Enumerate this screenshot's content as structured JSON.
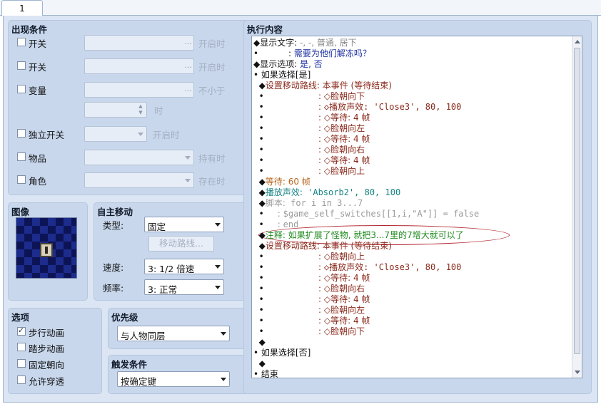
{
  "tab": {
    "label": "1"
  },
  "conditions": {
    "title": "出现条件",
    "switch1": {
      "label": "开关",
      "value": "...",
      "suffix": "开启时"
    },
    "switch2": {
      "label": "开关",
      "value": "...",
      "suffix": "开启时"
    },
    "variable": {
      "label": "变量",
      "value": "...",
      "suffix": "不小于",
      "amount_suffix": "时"
    },
    "self_switch": {
      "label": "独立开关",
      "suffix": "开启时"
    },
    "item": {
      "label": "物品",
      "suffix": "持有时"
    },
    "actor": {
      "label": "角色",
      "suffix": "存在时"
    }
  },
  "image": {
    "title": "图像"
  },
  "autonomous": {
    "title": "自主移动",
    "type_label": "类型:",
    "type_value": "固定",
    "route_button": "移动路线...",
    "speed_label": "速度:",
    "speed_value": "3: 1/2 倍速",
    "freq_label": "频率:",
    "freq_value": "3: 正常"
  },
  "options": {
    "title": "选项",
    "items": [
      {
        "label": "步行动画",
        "checked": true
      },
      {
        "label": "踏步动画",
        "checked": false
      },
      {
        "label": "固定朝向",
        "checked": false
      },
      {
        "label": "允许穿透",
        "checked": false
      }
    ]
  },
  "priority": {
    "title": "优先级",
    "value": "与人物同层"
  },
  "trigger": {
    "title": "触发条件",
    "value": "按确定键"
  },
  "contents": {
    "title": "执行内容",
    "colors": {
      "command": "#111111",
      "param": "#8a8a8a",
      "blue": "#1b2fa0",
      "brown": "#8a2a1c",
      "orange": "#b8641a",
      "teal": "#178383",
      "green": "#1f8a1f",
      "gray": "#9a9a9a"
    },
    "lines": [
      {
        "prefix": "◆",
        "head": "显示文字:",
        "text": " -, -, 普通, 居下",
        "color": "param"
      },
      {
        "prefix": "•",
        "head": "           : ",
        "text": "需要为他们解冻吗？",
        "color": "blue"
      },
      {
        "prefix": "◆",
        "head": "显示选项:",
        "text": " 是, 否",
        "color": "blue"
      },
      {
        "prefix": "•",
        "head": " 如果选择[是]",
        "text": "",
        "color": "command"
      },
      {
        "prefix": "  ◆",
        "head": "设置移动路线:",
        "text": " 本事件 (等待结束)",
        "color": "brown"
      },
      {
        "prefix": "  •",
        "head": "                    : ",
        "text": "◇脸朝向下",
        "color": "brown"
      },
      {
        "prefix": "  •",
        "head": "                    : ",
        "text": "◇播放声效: 'Close3', 80, 100",
        "color": "brown"
      },
      {
        "prefix": "  •",
        "head": "                    : ",
        "text": "◇等待: 4 帧",
        "color": "brown"
      },
      {
        "prefix": "  •",
        "head": "                    : ",
        "text": "◇脸朝向左",
        "color": "brown"
      },
      {
        "prefix": "  •",
        "head": "                    : ",
        "text": "◇等待: 4 帧",
        "color": "brown"
      },
      {
        "prefix": "  •",
        "head": "                    : ",
        "text": "◇脸朝向右",
        "color": "brown"
      },
      {
        "prefix": "  •",
        "head": "                    : ",
        "text": "◇等待: 4 帧",
        "color": "brown"
      },
      {
        "prefix": "  •",
        "head": "                    : ",
        "text": "◇脸朝向上",
        "color": "brown"
      },
      {
        "prefix": "  ◆",
        "head": "等待:",
        "text": " 60 帧",
        "color": "orange"
      },
      {
        "prefix": "  ◆",
        "head": "播放声效:",
        "text": " 'Absorb2', 80, 100",
        "color": "teal"
      },
      {
        "prefix": "  ◆",
        "head": "脚本:",
        "text": " for i in 3...7",
        "color": "gray"
      },
      {
        "prefix": "  •",
        "head": "     : ",
        "text": "$game_self_switches[[1,i,\"A\"]] = false",
        "color": "gray"
      },
      {
        "prefix": "  •",
        "head": "     : ",
        "text": "end",
        "color": "gray"
      },
      {
        "prefix": "  ◆",
        "head": "注释:",
        "text": " 如果扩展了怪物, 就把3...7里的7增大就可以了",
        "color": "green"
      },
      {
        "prefix": "  ◆",
        "head": "设置移动路线:",
        "text": " 本事件 (等待结束)",
        "color": "brown"
      },
      {
        "prefix": "  •",
        "head": "                    : ",
        "text": "◇脸朝向上",
        "color": "brown"
      },
      {
        "prefix": "  •",
        "head": "                    : ",
        "text": "◇播放声效: 'Close3', 80, 100",
        "color": "brown"
      },
      {
        "prefix": "  •",
        "head": "                    : ",
        "text": "◇等待: 4 帧",
        "color": "brown"
      },
      {
        "prefix": "  •",
        "head": "                    : ",
        "text": "◇脸朝向右",
        "color": "brown"
      },
      {
        "prefix": "  •",
        "head": "                    : ",
        "text": "◇等待: 4 帧",
        "color": "brown"
      },
      {
        "prefix": "  •",
        "head": "                    : ",
        "text": "◇脸朝向左",
        "color": "brown"
      },
      {
        "prefix": "  •",
        "head": "                    : ",
        "text": "◇等待: 4 帧",
        "color": "brown"
      },
      {
        "prefix": "  •",
        "head": "                    : ",
        "text": "◇脸朝向下",
        "color": "brown"
      },
      {
        "prefix": "  ◆",
        "head": "",
        "text": "",
        "color": "command"
      },
      {
        "prefix": "•",
        "head": " 如果选择[否]",
        "text": "",
        "color": "command"
      },
      {
        "prefix": "  ◆",
        "head": "",
        "text": "",
        "color": "command"
      },
      {
        "prefix": "•",
        "head": " 结束",
        "text": "",
        "color": "command"
      }
    ]
  }
}
